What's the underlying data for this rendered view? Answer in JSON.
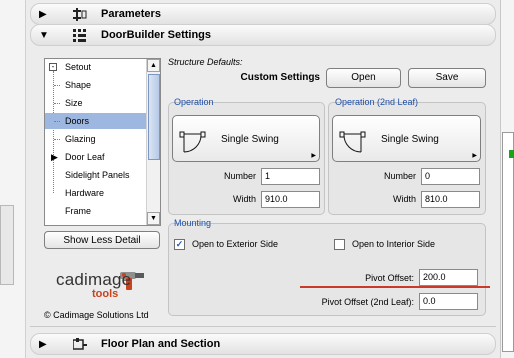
{
  "sections": {
    "parameters": "Parameters",
    "doorbuilder": "DoorBuilder Settings",
    "floorplan": "Floor Plan and Section"
  },
  "tree": {
    "items": [
      {
        "label": "Setout",
        "expander": "minus"
      },
      {
        "label": "Shape"
      },
      {
        "label": "Size"
      },
      {
        "label": "Doors",
        "selected": true
      },
      {
        "label": "Glazing"
      },
      {
        "label": "Door Leaf",
        "expander": "right-arrow"
      },
      {
        "label": "Sidelight Panels"
      },
      {
        "label": "Hardware"
      },
      {
        "label": "Frame"
      }
    ]
  },
  "show_less_label": "Show Less Detail",
  "structure_defaults_label": "Structure Defaults:",
  "custom_settings_label": "Custom Settings",
  "open_label": "Open",
  "save_label": "Save",
  "operation": {
    "title": "Operation",
    "swing_label": "Single Swing",
    "number_label": "Number",
    "number_value": "1",
    "width_label": "Width",
    "width_value": "910.0"
  },
  "operation2": {
    "title": "Operation (2nd Leaf)",
    "swing_label": "Single Swing",
    "number_label": "Number",
    "number_value": "0",
    "width_label": "Width",
    "width_value": "810.0"
  },
  "mounting": {
    "title": "Mounting",
    "exterior_label": "Open to Exterior Side",
    "exterior_checked": true,
    "interior_label": "Open to Interior Side",
    "interior_checked": false,
    "pivot_label": "Pivot Offset:",
    "pivot_value": "200.0",
    "pivot2_label": "Pivot Offset (2nd Leaf):",
    "pivot2_value": "0.0"
  },
  "logo": {
    "name": "cadimage",
    "sub": "tools"
  },
  "copyright": "© Cadimage Solutions Ltd",
  "colors": {
    "selection": "#9db7e0",
    "group_title": "#1f4fa8",
    "highlight_line": "#c93a2a",
    "logo_accent": "#c8431e"
  }
}
